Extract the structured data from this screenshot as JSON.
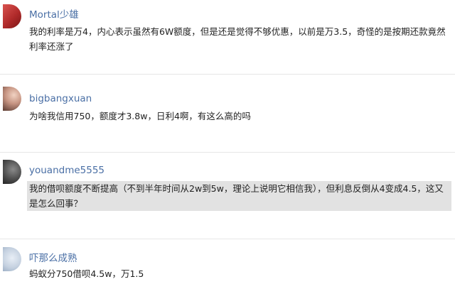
{
  "comments": [
    {
      "username": "Mortal少雄",
      "text": "我的利率是万4，内心表示虽然有6W额度，但是还是觉得不够优惠，以前是万3.5，奇怪的是按期还款竟然利率还涨了"
    },
    {
      "username": "bigbangxuan",
      "text": "为啥我信用750，额度才3.8w，日利4啊，有这么高的吗"
    },
    {
      "username": "youandme5555",
      "text": "我的借呗额度不断提高（不到半年时间从2w到5w，理论上说明它相信我），但利息反倒从4变成4.5，这又是怎么回事？",
      "highlighted": true
    },
    {
      "username": "吓那么成熟",
      "text": "蚂蚁分750借呗4.5w，万1.5"
    }
  ]
}
